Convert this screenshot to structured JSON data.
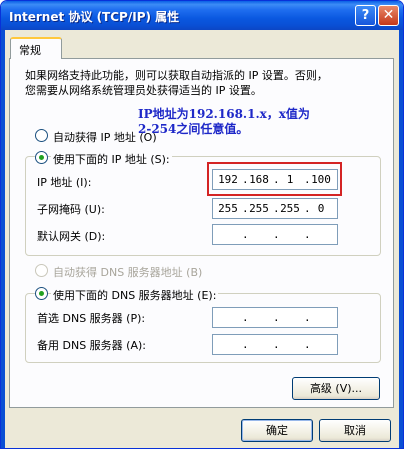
{
  "window": {
    "title": "Internet 协议 (TCP/IP) 属性"
  },
  "titlebar": {
    "help_label": "?",
    "close_label": "✕"
  },
  "tabs": [
    {
      "label": "常规"
    }
  ],
  "description": {
    "line1": "如果网络支持此功能，则可以获取自动指派的 IP 设置。否则，",
    "line2": "您需要从网络系统管理员处获得适当的 IP 设置。"
  },
  "annotation": {
    "line1": "IP地址为192.168.1.x，x值为",
    "line2": "2-254之间任意值。"
  },
  "ip_section": {
    "auto_label": "自动获得 IP 地址 (O)",
    "manual_label": "使用下面的 IP 地址 (S):",
    "ip_label": "IP 地址 (I):",
    "ip_octets": [
      "192",
      "168",
      "1",
      "100"
    ],
    "mask_label": "子网掩码 (U):",
    "mask_octets": [
      "255",
      "255",
      "255",
      "0"
    ],
    "gateway_label": "默认网关 (D):",
    "gateway_octets": [
      "",
      "",
      "",
      ""
    ]
  },
  "dns_section": {
    "auto_label": "自动获得 DNS 服务器地址 (B)",
    "manual_label": "使用下面的 DNS 服务器地址 (E):",
    "preferred_label": "首选 DNS 服务器 (P):",
    "preferred_octets": [
      "",
      "",
      "",
      ""
    ],
    "alternate_label": "备用 DNS 服务器 (A):",
    "alternate_octets": [
      "",
      "",
      "",
      ""
    ]
  },
  "buttons": {
    "advanced": "高级 (V)...",
    "ok": "确定",
    "cancel": "取消"
  },
  "dot": "."
}
